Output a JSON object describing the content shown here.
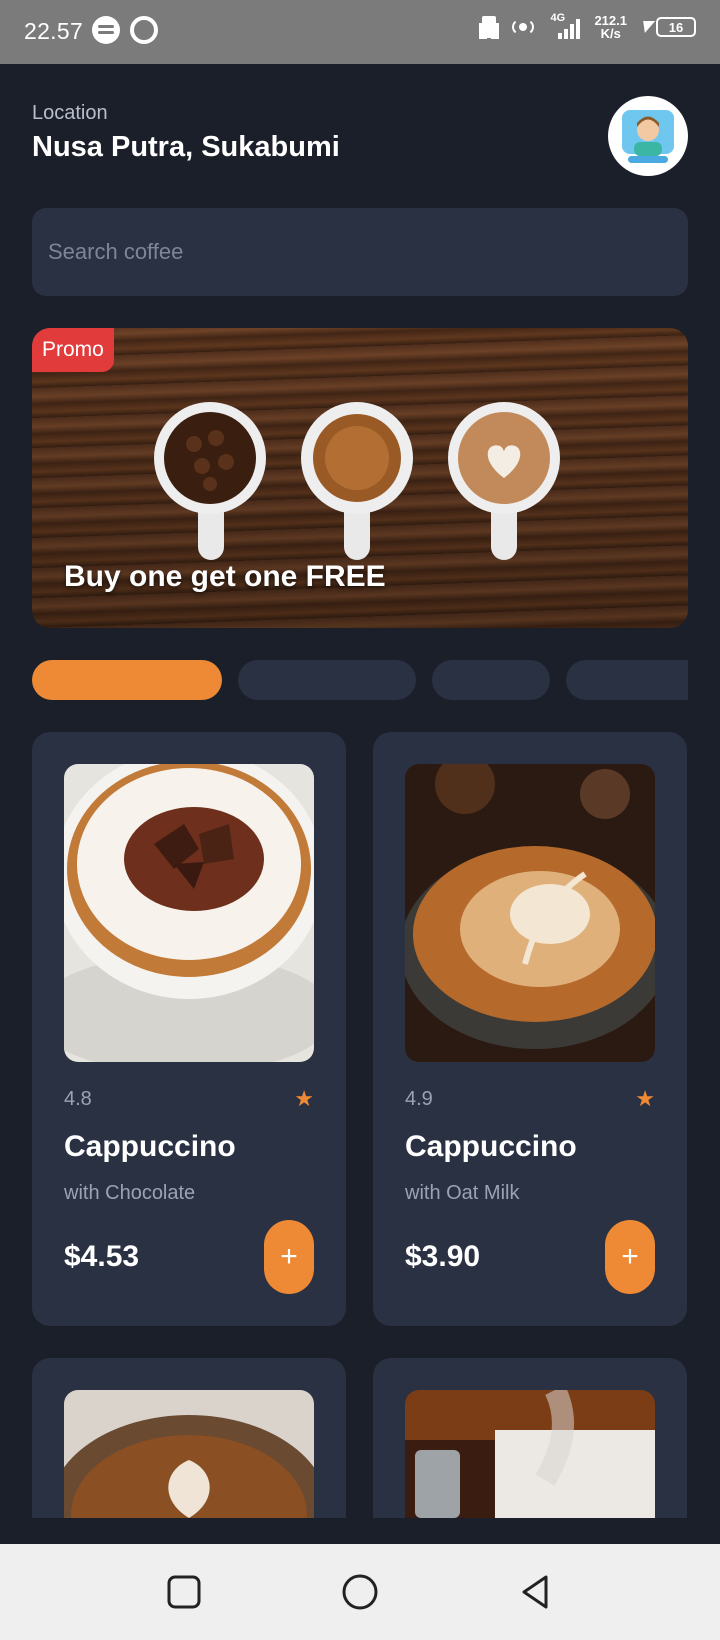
{
  "status_bar": {
    "time": "22.57",
    "network_type": "4G",
    "speed_value": "212.1",
    "speed_unit": "K/s",
    "battery": "16"
  },
  "header": {
    "location_label": "Location",
    "location_name": "Nusa Putra, Sukabumi"
  },
  "search": {
    "placeholder": "Search coffee"
  },
  "promo": {
    "badge": "Promo",
    "title": "Buy one get one FREE"
  },
  "categories": {
    "active_index": 0,
    "count": 4
  },
  "products": [
    {
      "rating": "4.8",
      "name": "Cappuccino",
      "subtitle": "with Chocolate",
      "price": "$4.53",
      "add_label": "+"
    },
    {
      "rating": "4.9",
      "name": "Cappuccino",
      "subtitle": "with Oat Milk",
      "price": "$3.90",
      "add_label": "+"
    }
  ],
  "colors": {
    "background": "#1b1f2a",
    "surface": "#2a3142",
    "accent": "#ee8a35",
    "promo_badge": "#e23b3b"
  }
}
